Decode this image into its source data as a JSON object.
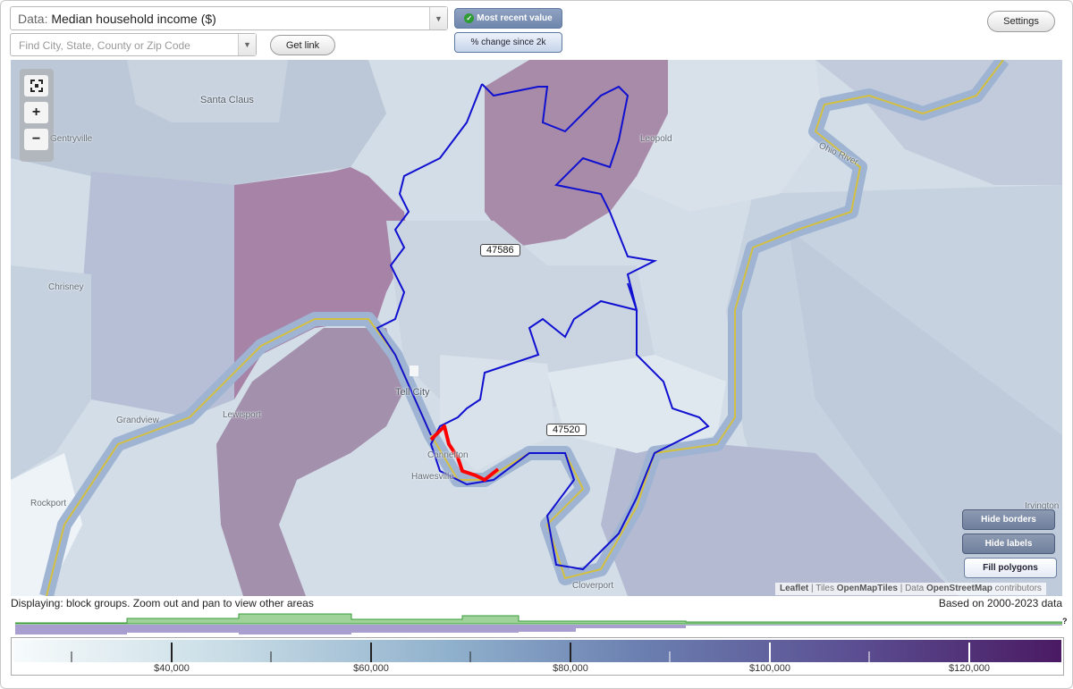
{
  "header": {
    "data_prefix": "Data:",
    "data_value": "Median household income ($)",
    "search_placeholder": "Find City, State, County or Zip Code",
    "get_link": "Get link",
    "toggle_recent": "Most recent value",
    "toggle_change": "% change since 2k",
    "settings": "Settings"
  },
  "map": {
    "zip_labels": [
      "47586",
      "47520"
    ],
    "places": [
      "Santa Claus",
      "Gentryville",
      "Leopold",
      "Chrisney",
      "Tell City",
      "Grandview",
      "Lewisport",
      "Cannelton",
      "Hawesville",
      "Rockport",
      "Cloverport",
      "Irvington",
      "Ohio River"
    ],
    "buttons": {
      "hide_borders": "Hide borders",
      "hide_labels": "Hide labels",
      "fill_polygons": "Fill polygons"
    },
    "attribution": {
      "leaflet": "Leaflet",
      "sep1": "| Tiles",
      "tiles": "OpenMapTiles",
      "sep2": "| Data",
      "data": "OpenStreetMap",
      "contrib": "contributors"
    },
    "colors": {
      "zip_border": "#1010d0",
      "highlight": "#ff0000",
      "river": "#d4c040"
    }
  },
  "footer": {
    "displaying": "Displaying: block groups. Zoom out and pan to view other areas",
    "based_on": "Based on 2000-2023 data",
    "hist_q": "?"
  },
  "legend": {
    "labels": [
      "$40,000",
      "$60,000",
      "$80,000",
      "$100,000",
      "$120,000"
    ]
  }
}
